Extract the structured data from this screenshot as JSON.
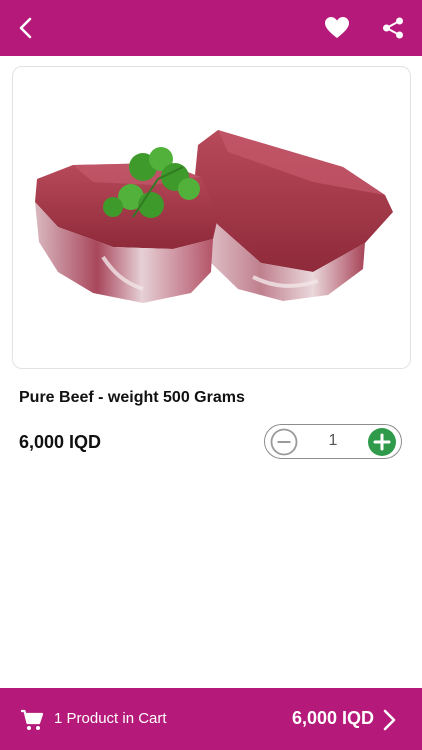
{
  "header": {
    "back_icon": "chevron-left-icon",
    "favorite_icon": "heart-icon",
    "share_icon": "share-icon"
  },
  "product": {
    "image_description_icon": "product-image",
    "name": "Pure Beef - weight 500 Grams",
    "price": "6,000 IQD",
    "quantity": "1"
  },
  "cart_bar": {
    "icon": "cart-icon",
    "count_text": "1 Product in Cart",
    "total": "6,000 IQD"
  },
  "colors": {
    "brand": "#b5197a",
    "plus_button": "#2f9b4a",
    "minus_button": "#9a9a9a"
  }
}
